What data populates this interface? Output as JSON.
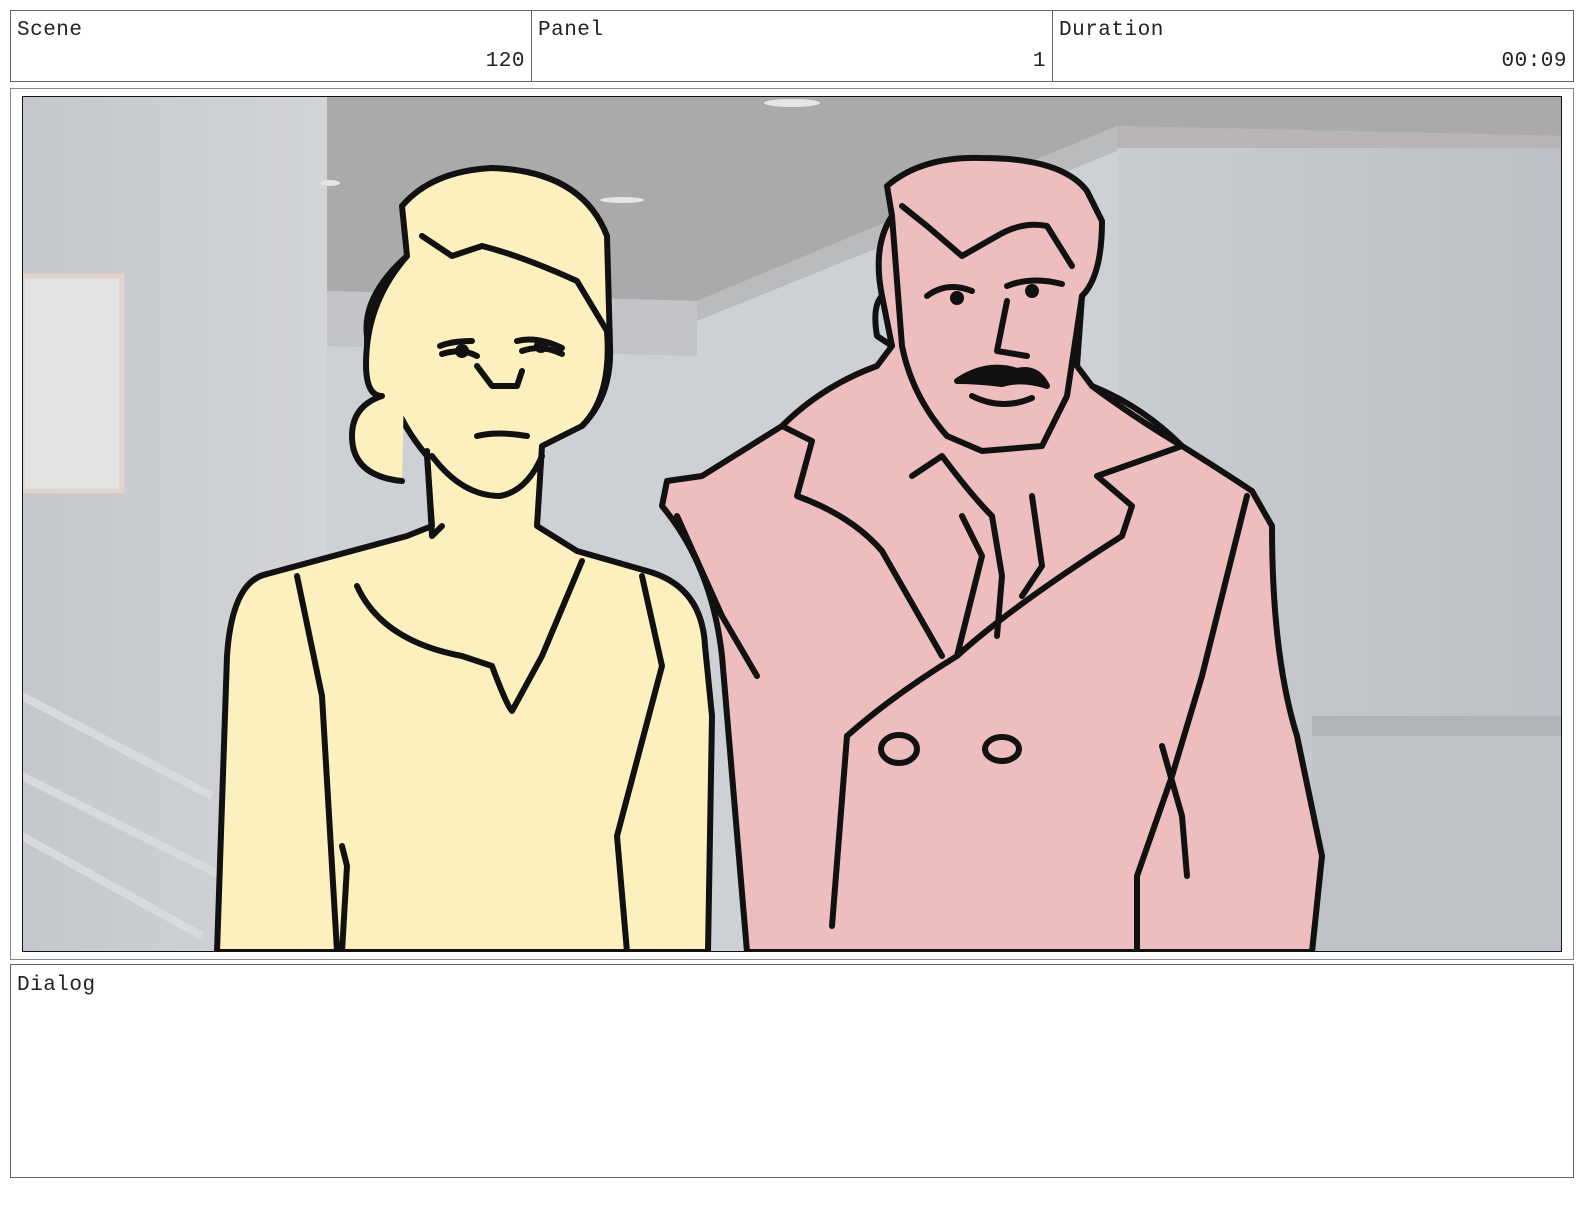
{
  "header": {
    "scene": {
      "label": "Scene",
      "value": "120"
    },
    "panel": {
      "label": "Panel",
      "value": "1"
    },
    "duration": {
      "label": "Duration",
      "value": "00:09"
    }
  },
  "dialog": {
    "label": "Dialog",
    "text": ""
  },
  "colors": {
    "woman_fill": "#fdf0bf",
    "man_fill": "#eebdbd",
    "line": "#111111",
    "wall": "#cbced3",
    "ceiling": "#a9abab"
  },
  "artwork": {
    "characters": [
      "blonde-woman-worried",
      "mustached-man-in-trench-coat"
    ],
    "background": "hallway-interior"
  }
}
